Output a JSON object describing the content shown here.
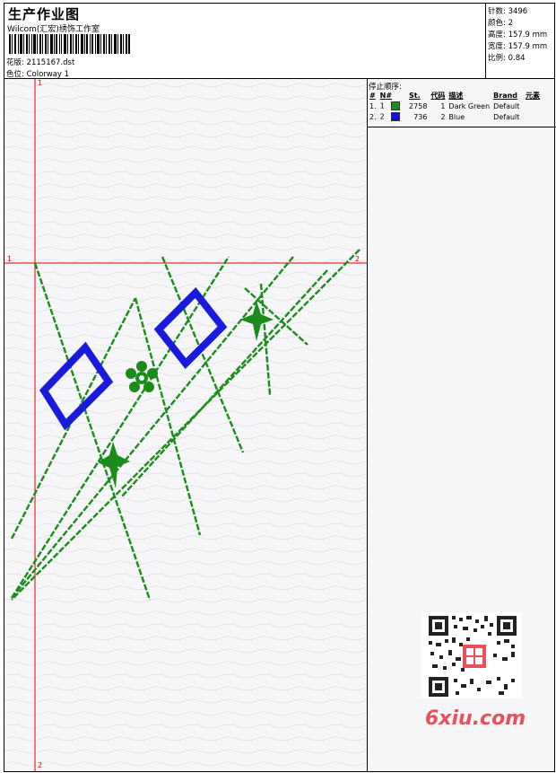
{
  "header": {
    "title": "生产作业图",
    "company": "Wilcom(汇宏)绣饰工作室",
    "design_label": "花版:",
    "design_value": "2115167.dst",
    "colorway_label": "色位:",
    "colorway_value": "Colorway 1"
  },
  "stats": [
    {
      "label": "针数:",
      "value": "3496"
    },
    {
      "label": "颜色:",
      "value": "2"
    },
    {
      "label": "高度:",
      "value": "157.9 mm"
    },
    {
      "label": "宽度:",
      "value": "157.9 mm"
    },
    {
      "label": "比例:",
      "value": "0.84"
    }
  ],
  "stop_sequence": {
    "title": "停止顺序:",
    "headers": [
      "#",
      "N#",
      "St.",
      "代码",
      "描述",
      "Brand",
      "元素"
    ],
    "rows": [
      {
        "num": "1.",
        "needle": "1",
        "stitches": "2758",
        "code": "1",
        "description": "Dark Green",
        "brand": "Default",
        "color": "#1a8c1a"
      },
      {
        "num": "2.",
        "needle": "2",
        "stitches": "736",
        "code": "2",
        "description": "Blue",
        "brand": "Default",
        "color": "#1010e0"
      }
    ]
  },
  "axis_labels": {
    "top": "1",
    "left": "1",
    "right": "2",
    "bottom": "2"
  },
  "watermark": "6xiu.com",
  "colors": {
    "green": "#1a8c1a",
    "blue": "#1a1adc",
    "axis": "#e00000"
  }
}
